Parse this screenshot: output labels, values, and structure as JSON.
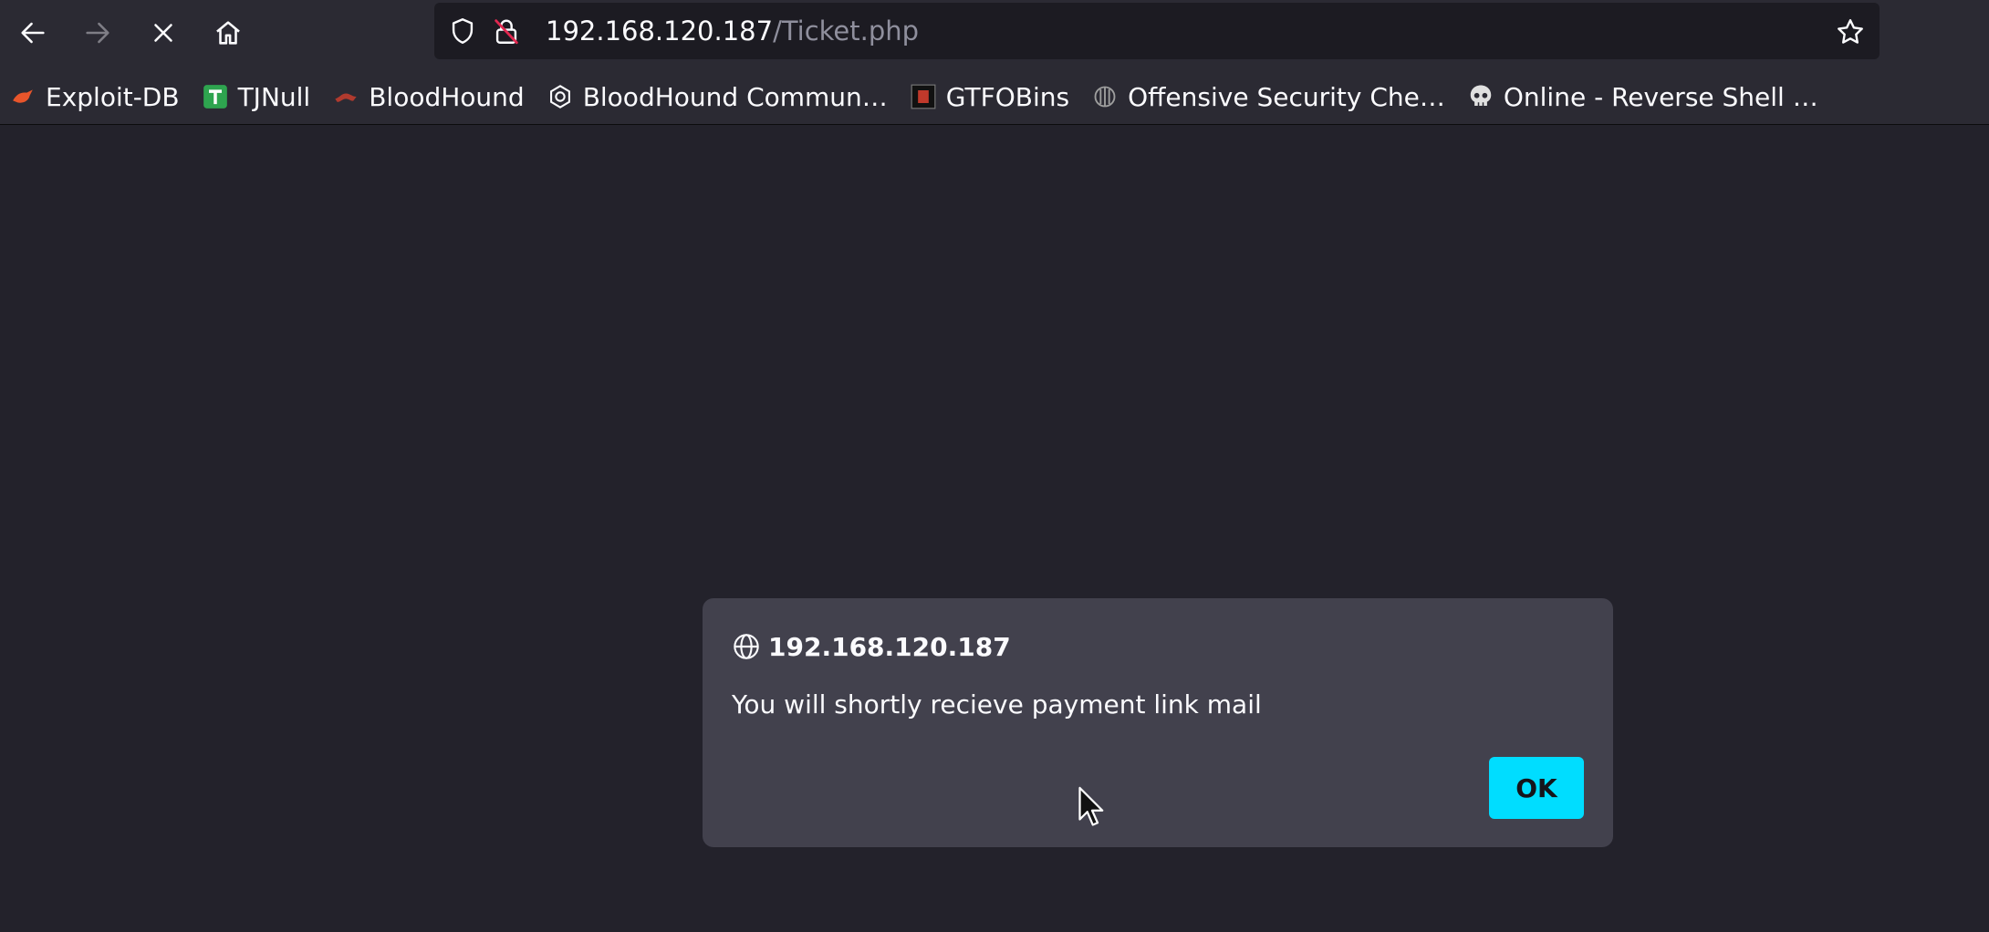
{
  "browser": {
    "url_host": "192.168.120.187",
    "url_path": "/Ticket.php"
  },
  "nav_icons": [
    "back-arrow-icon",
    "forward-arrow-icon",
    "stop-loading-icon",
    "home-icon"
  ],
  "bookmarks": [
    {
      "label": "Exploit-DB",
      "icon": "exploit-db-icon",
      "color": "#e8552b"
    },
    {
      "label": "TJNull",
      "icon": "tjnull-icon",
      "color": "#2ea44f"
    },
    {
      "label": "BloodHound",
      "icon": "bloodhound-icon",
      "color": "#b03a2e"
    },
    {
      "label": "BloodHound Commun…",
      "icon": "bloodhound-community-icon",
      "color": "#fbfbfe"
    },
    {
      "label": "GTFOBins",
      "icon": "gtfobins-icon",
      "color": "#c0392b"
    },
    {
      "label": "Offensive Security Che…",
      "icon": "offsec-icon",
      "color": "#9e9e9e"
    },
    {
      "label": "Online - Reverse Shell …",
      "icon": "skull-icon",
      "color": "#e0e0e0"
    }
  ],
  "dialog": {
    "title": "192.168.120.187",
    "message": "You will shortly recieve payment link mail",
    "ok_label": "OK"
  },
  "colors": {
    "page_background": "#23222b",
    "toolbar_background": "#2b2a33",
    "urlbar_background": "#1c1b22",
    "dialog_background": "#42414d",
    "accent": "#00ddff"
  }
}
